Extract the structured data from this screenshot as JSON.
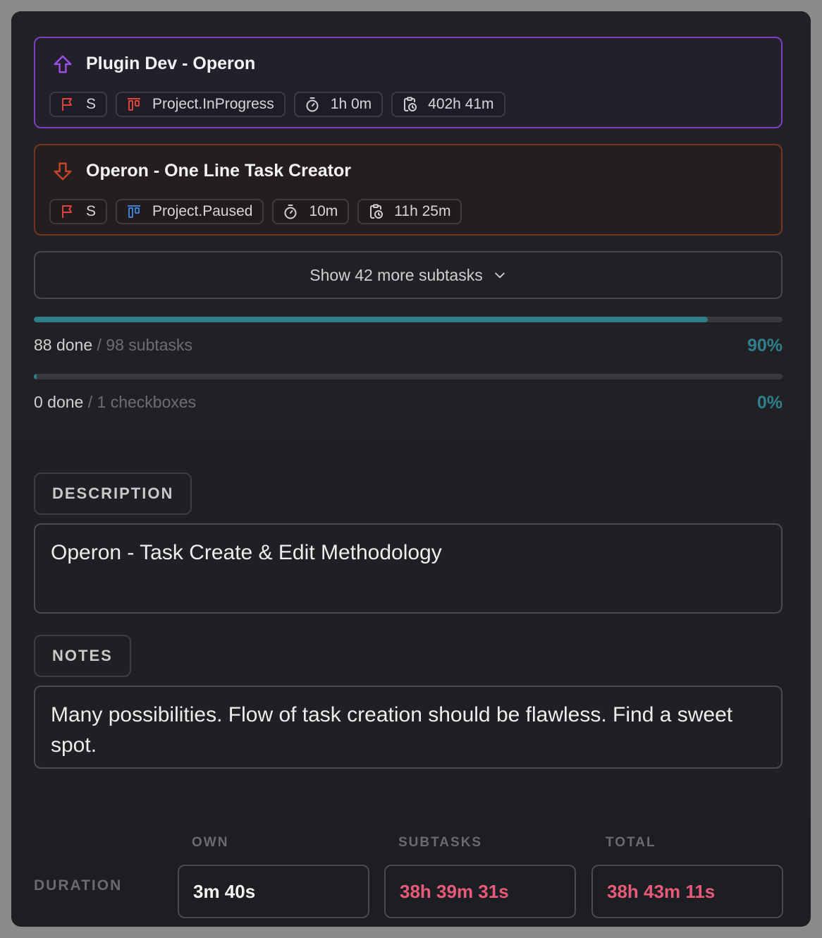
{
  "tasks": [
    {
      "title": "Plugin Dev - Operon",
      "direction": "up",
      "accent": "#9a4fe0",
      "priority": "S",
      "status": "Project.InProgress",
      "status_color": "#d9453a",
      "estimate": "1h 0m",
      "logged": "402h 41m"
    },
    {
      "title": "Operon - One Line Task Creator",
      "direction": "down",
      "accent": "#c2452b",
      "priority": "S",
      "status": "Project.Paused",
      "status_color": "#3d7fd6",
      "estimate": "10m",
      "logged": "11h 25m"
    }
  ],
  "show_more_label": "Show 42 more subtasks",
  "progress": {
    "subtasks": {
      "done": "88 done",
      "total": "/ 98 subtasks",
      "percent": "90%",
      "fraction": 0.9
    },
    "checkboxes": {
      "done": "0 done",
      "total": "/ 1 checkboxes",
      "percent": "0%",
      "fraction": 0.0
    }
  },
  "description": {
    "label": "DESCRIPTION",
    "text": "Operon - Task Create & Edit Methodology"
  },
  "notes": {
    "label": "NOTES",
    "text": "Many possibilities. Flow of task creation should be flawless. Find a sweet spot."
  },
  "duration": {
    "label": "DURATION",
    "columns": [
      "OWN",
      "SUBTASKS",
      "TOTAL"
    ],
    "own": "3m 40s",
    "subtasks": "38h 39m 31s",
    "total": "38h 43m 11s",
    "own_color": "#f2f2f2",
    "highlight_color": "#e85a7a"
  },
  "colors": {
    "flag": "#d9453a",
    "progress": "#2e7d8b"
  }
}
